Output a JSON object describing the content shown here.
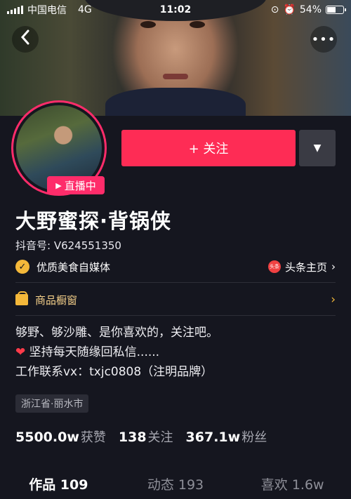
{
  "status_bar": {
    "carrier": "中国电信",
    "network": "4G",
    "time": "11:02",
    "battery": "54%",
    "battery_level": 0.54
  },
  "nav": {
    "back_icon": "chevron-left-icon",
    "more_icon": "more-dots-icon",
    "more_label": "•••"
  },
  "profile": {
    "live_badge": "直播中",
    "follow_label": "+ 关注",
    "dropdown_icon": "caret-down-icon",
    "name": "大野蜜探·背锅侠",
    "douyin_id": "抖音号: V624551350",
    "verified_label": "优质美食自媒体",
    "toutiao_icon_text": "头条",
    "toutiao_label": "头条主页",
    "shop_label": "商品橱窗",
    "bio": [
      "够野、够沙雕、是你喜欢的，关注吧。",
      "坚持每天随缘回私信......",
      "工作联系vx：txjc0808（注明品牌）"
    ],
    "location": "浙江省·丽水市"
  },
  "stats": {
    "likes_num": "5500.0w",
    "likes_label": "获赞",
    "following_num": "138",
    "following_label": "关注",
    "followers_num": "367.1w",
    "followers_label": "粉丝"
  },
  "tabs": [
    {
      "label": "作品 109",
      "active": true
    },
    {
      "label": "动态 193",
      "active": false
    },
    {
      "label": "喜欢 1.6w",
      "active": false
    }
  ],
  "colors": {
    "accent": "#fe2c55",
    "background": "#15161f",
    "gold": "#f4b83a"
  }
}
